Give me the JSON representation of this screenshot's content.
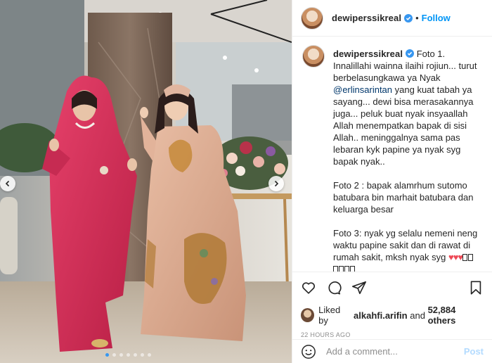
{
  "post": {
    "username": "dewiperssikreal",
    "follow_label": "Follow",
    "separator": "•",
    "caption": {
      "intro": "Foto 1. Innalillahi wainna ilaihi rojiun... turut berbelasungkawa ya Nyak",
      "mention": "@erlinsarintan",
      "after_mention": "yang kuat tabah ya sayang... dewi bisa merasakannya juga... peluk buat nyak insyaallah Allah menempatkan bapak di sisi Allah.. meninggalnya sama pas lebaran kyk papine ya nyak syg bapak nyak..",
      "para2": "Foto 2 : bapak alamrhum sutomo batubara bin marhait batubara dan keluarga besar",
      "para3": "Foto 3: nyak yg selalu nemeni neng waktu papine sakit dan di rawat di rumah sakit, mksh nyak syg",
      "hearts": "♥♥♥"
    },
    "likes": {
      "prefix": "Liked by",
      "liker": "alkahfi.arifin",
      "connector": "and",
      "others": "52,884 others"
    },
    "timestamp": "22 HOURS AGO",
    "comment_input": {
      "placeholder": "Add a comment..."
    },
    "post_label": "Post"
  },
  "carousel": {
    "slide_count": 7,
    "active_index": 0
  },
  "colors": {
    "accent": "#0095f6",
    "heart": "#ed4956",
    "dress_left": "#d8325a",
    "dress_right": "#d9a98e"
  },
  "icons": [
    "verified-icon",
    "heart-icon",
    "comment-icon",
    "share-icon",
    "bookmark-icon",
    "emoji-icon",
    "chevron-left-icon",
    "chevron-right-icon"
  ]
}
